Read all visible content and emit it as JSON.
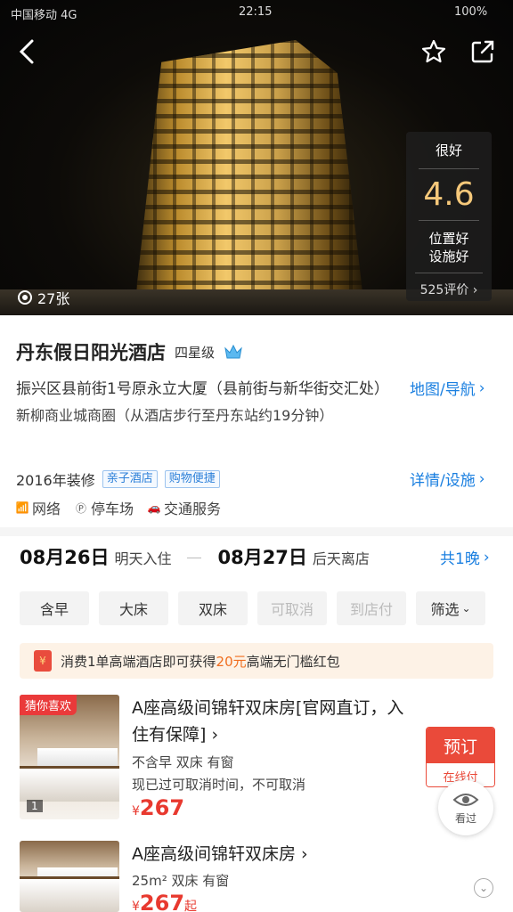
{
  "status_bar": {
    "carrier": "中国移动 4G",
    "time": "22:15",
    "battery": "100%"
  },
  "hero": {
    "photo_count": "27张",
    "rating": {
      "level": "很好",
      "score": "4.6",
      "tags": [
        "位置好",
        "设施好"
      ],
      "reviews": "525评价"
    }
  },
  "hotel": {
    "name": "丹东假日阳光酒店",
    "star": "四星级",
    "address": "振兴区县前街1号原永立大厦（县前街与新华街交汇处）",
    "area": "新柳商业城商圈（从酒店步行至丹东站约19分钟）",
    "map_link": "地图/导航",
    "renovation": "2016年装修",
    "tags": [
      "亲子酒店",
      "购物便捷"
    ],
    "detail_link": "详情/设施",
    "facilities": [
      "网络",
      "停车场",
      "交通服务"
    ]
  },
  "stay": {
    "checkin_date": "08月26日",
    "checkin_label": "明天入住",
    "checkout_date": "08月27日",
    "checkout_label": "后天离店",
    "nights": "共1晚"
  },
  "filters": [
    {
      "label": "含早",
      "enabled": true
    },
    {
      "label": "大床",
      "enabled": true
    },
    {
      "label": "双床",
      "enabled": true
    },
    {
      "label": "可取消",
      "enabled": false
    },
    {
      "label": "到店付",
      "enabled": false
    },
    {
      "label": "筛选",
      "enabled": true
    }
  ],
  "promo": {
    "prefix": "消费1单高端酒店即可获得",
    "amount": "20元",
    "suffix": "高端无门槛红包"
  },
  "rooms": [
    {
      "badge": "猜你喜欢",
      "image_count": "1",
      "title": "A座高级间锦轩双床房[官网直订，入住有保障]",
      "meta": "不含早  双床  有窗",
      "cancel": "现已过可取消时间，不可取消",
      "currency": "¥",
      "price": "267",
      "price_suffix": "",
      "book_label": "预订",
      "pay_label": "在线付"
    },
    {
      "title": "A座高级间锦轩双床房",
      "meta": "25m²  双床  有窗",
      "currency": "¥",
      "price": "267",
      "price_suffix": "起"
    }
  ],
  "viewed_label": "看过",
  "colors": {
    "accent_blue": "#1a7fe0",
    "price_red": "#e8392f",
    "book_red": "#ea4a3a",
    "promo_orange": "#f06e1f"
  }
}
